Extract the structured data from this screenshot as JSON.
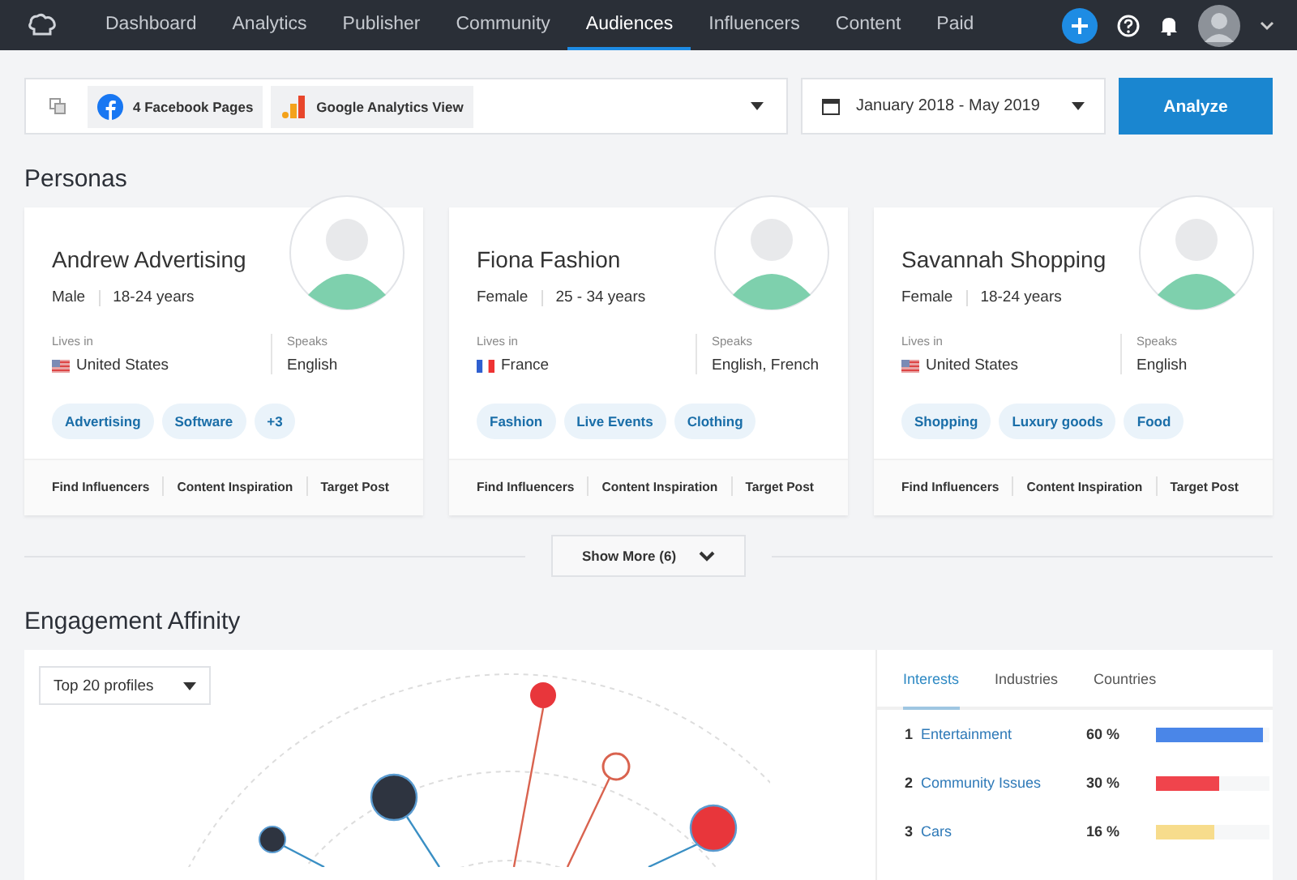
{
  "nav": {
    "items": [
      {
        "label": "Dashboard",
        "selected": false
      },
      {
        "label": "Analytics",
        "selected": false
      },
      {
        "label": "Publisher",
        "selected": false
      },
      {
        "label": "Community",
        "selected": false
      },
      {
        "label": "Audiences",
        "selected": true
      },
      {
        "label": "Influencers",
        "selected": false
      },
      {
        "label": "Content",
        "selected": false
      },
      {
        "label": "Paid",
        "selected": false
      }
    ]
  },
  "filter": {
    "sources": [
      "4 Facebook Pages",
      "Google Analytics View"
    ],
    "date_range": "January 2018 - May 2019",
    "analyze_button": "Analyze"
  },
  "personas_title": "Personas",
  "personas": [
    {
      "name": "Andrew Advertising",
      "gender": "Male",
      "age": "18-24 years",
      "lives_label": "Lives in",
      "residence": {
        "kind": "us",
        "country": "United States"
      },
      "speaks_label": "Speaks",
      "languages": "English",
      "tags": [
        "Advertising",
        "Software",
        "+3"
      ],
      "actions": [
        "Find Influencers",
        "Content Inspiration",
        "Target Post"
      ]
    },
    {
      "name": "Fiona Fashion",
      "gender": "Female",
      "age": "25 - 34 years",
      "lives_label": "Lives in",
      "residence": {
        "kind": "fr",
        "country": "France"
      },
      "speaks_label": "Speaks",
      "languages": "English, French",
      "tags": [
        "Fashion",
        "Live Events",
        "Clothing"
      ],
      "actions": [
        "Find Influencers",
        "Content Inspiration",
        "Target Post"
      ]
    },
    {
      "name": "Savannah Shopping",
      "gender": "Female",
      "age": "18-24 years",
      "lives_label": "Lives in",
      "residence": {
        "kind": "us",
        "country": "United States"
      },
      "speaks_label": "Speaks",
      "languages": "English",
      "tags": [
        "Shopping",
        "Luxury goods",
        "Food"
      ],
      "actions": [
        "Find Influencers",
        "Content Inspiration",
        "Target Post"
      ]
    }
  ],
  "show_more": "Show More (6)",
  "engagement_title": "Engagement Affinity",
  "profiles_select": "Top 20 profiles",
  "affinity_tabs": [
    {
      "label": "Interests",
      "selected": true
    },
    {
      "label": "Industries",
      "selected": false
    },
    {
      "label": "Countries",
      "selected": false
    }
  ],
  "interests": [
    {
      "rank": "1",
      "name": "Entertainment",
      "percent": "60 %",
      "level": 0.94,
      "color": "#4a86e8"
    },
    {
      "rank": "2",
      "name": "Community Issues",
      "percent": "30 %",
      "level": 0.56,
      "color": "#f0444c"
    },
    {
      "rank": "3",
      "name": "Cars",
      "percent": "16 %",
      "level": 0.51,
      "color": "#f7dc8c"
    }
  ]
}
